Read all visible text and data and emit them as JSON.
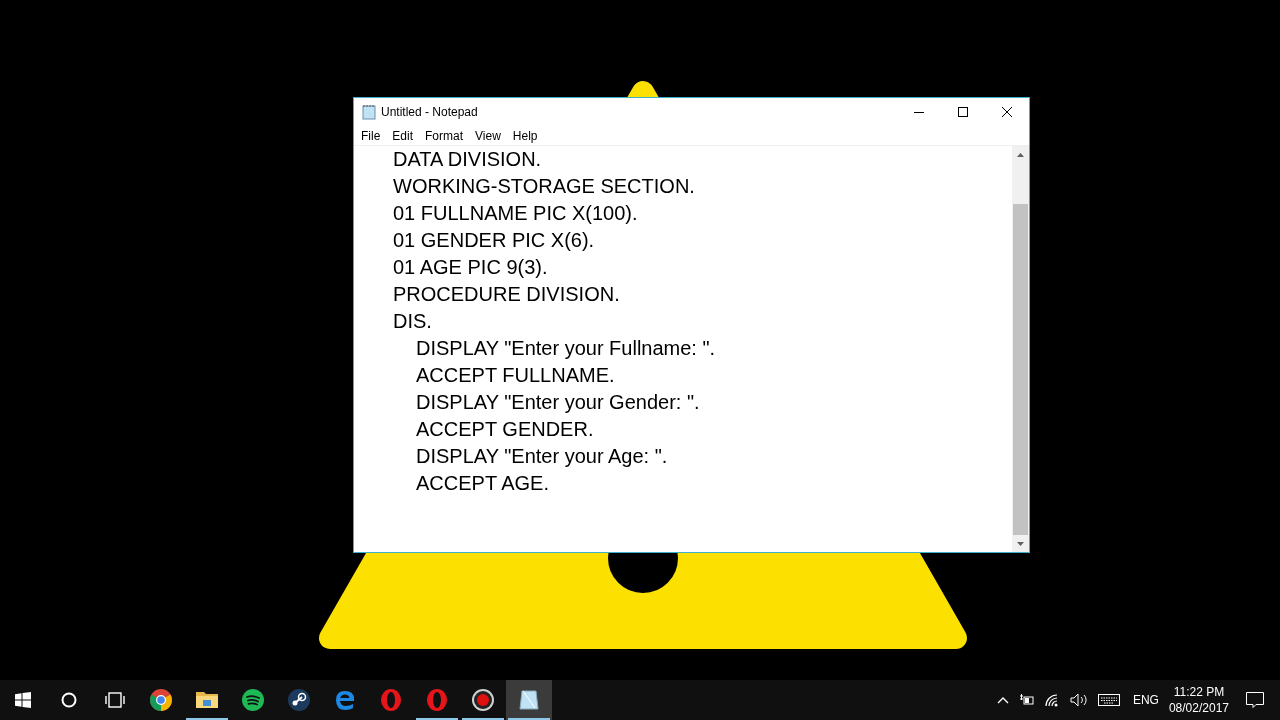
{
  "window": {
    "title": "Untitled - Notepad"
  },
  "menu": [
    "File",
    "Edit",
    "Format",
    "View",
    "Help"
  ],
  "editor": {
    "lines": [
      {
        "text": "DATA DIVISION."
      },
      {
        "text": "WORKING-STORAGE SECTION."
      },
      {
        "text": "01 FULLNAME PIC X(100)."
      },
      {
        "text": "01 GENDER PIC X(6)."
      },
      {
        "text": "01 AGE PIC 9(3)."
      },
      {
        "text": "PROCEDURE DIVISION."
      },
      {
        "text": "DIS.",
        "children": [
          {
            "text": "DISPLAY \"Enter your Fullname: \"."
          },
          {
            "text": "ACCEPT FULLNAME."
          },
          {
            "text": "DISPLAY \"Enter your Gender: \"."
          },
          {
            "text": "ACCEPT GENDER."
          },
          {
            "text": "DISPLAY \"Enter your Age: \"."
          },
          {
            "text": "ACCEPT AGE."
          }
        ]
      }
    ]
  },
  "taskbar": {
    "apps": [
      {
        "kind": "chrome",
        "running": false,
        "selected": false
      },
      {
        "kind": "explorer",
        "running": true,
        "selected": false
      },
      {
        "kind": "spotify",
        "running": false,
        "selected": false
      },
      {
        "kind": "steam",
        "running": false,
        "selected": false
      },
      {
        "kind": "edge",
        "running": false,
        "selected": false
      },
      {
        "kind": "opera",
        "running": false,
        "selected": false
      },
      {
        "kind": "opera",
        "running": true,
        "selected": false
      },
      {
        "kind": "recorder",
        "running": true,
        "selected": false
      },
      {
        "kind": "notepad",
        "running": true,
        "selected": true
      }
    ],
    "tray": {
      "language": "ENG",
      "time": "11:22 PM",
      "date": "08/02/2017"
    }
  }
}
